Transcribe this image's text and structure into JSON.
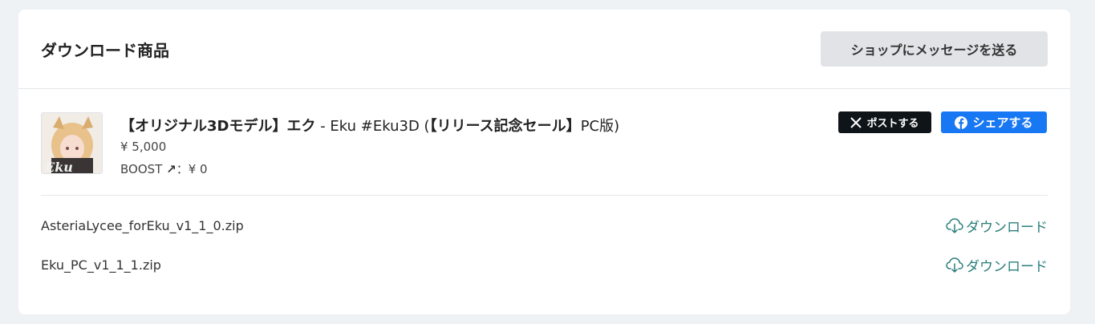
{
  "header": {
    "title": "ダウンロード商品",
    "message_button": "ショップにメッセージを送る"
  },
  "product": {
    "title_bold": "【オリジナル3Dモデル】エク",
    "title_mid": " - Eku #Eku3D (",
    "title_bold2": "【リリース記念セール】",
    "title_end": "PC版)",
    "price": "¥ 5,000",
    "boost_label": "BOOST",
    "boost_value": "：¥ 0",
    "thumbnail_text": "Eku"
  },
  "share": {
    "x_label": "ポストする",
    "fb_label": "シェアする"
  },
  "files": [
    {
      "name": "AsteriaLycee_forEku_v1_1_0.zip",
      "download_label": "ダウンロード"
    },
    {
      "name": "Eku_PC_v1_1_1.zip",
      "download_label": "ダウンロード"
    }
  ],
  "colors": {
    "accent_link": "#2a7f7a",
    "facebook": "#1877f2",
    "x_black": "#0f1419"
  },
  "icons": {
    "x": "x-logo-icon",
    "facebook": "facebook-icon",
    "download": "cloud-download-icon",
    "boost": "arrow-up-right-icon"
  }
}
